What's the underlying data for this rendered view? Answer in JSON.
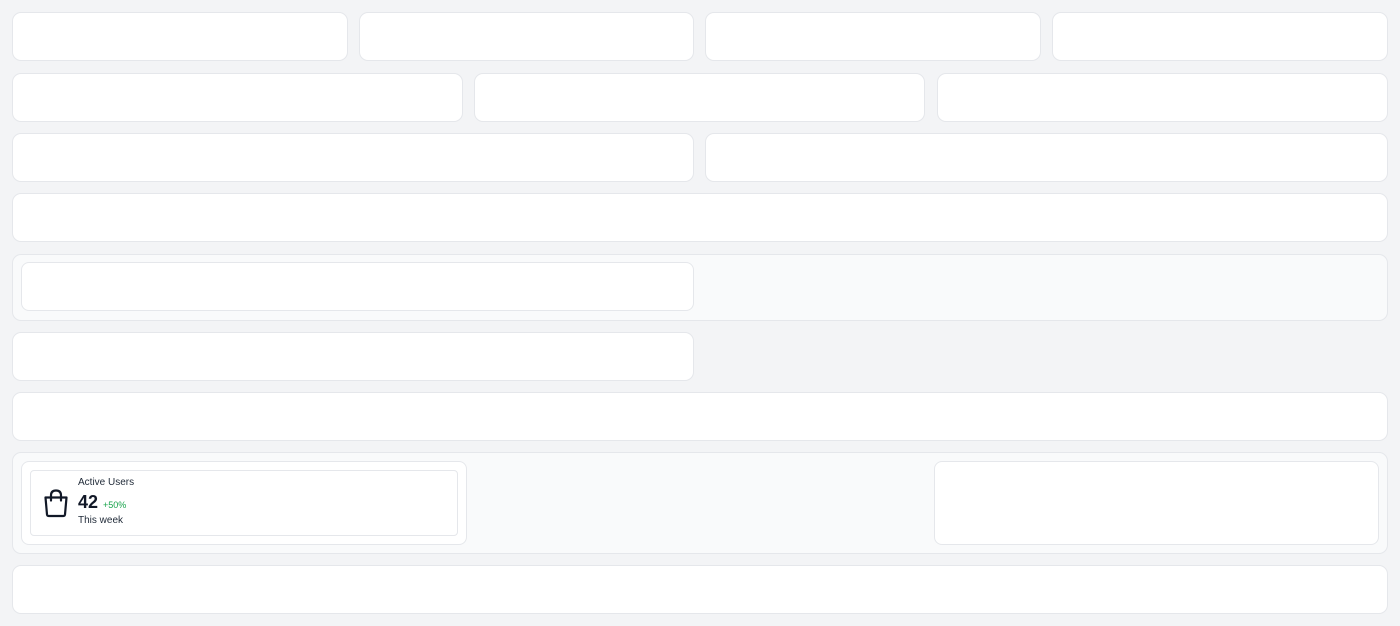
{
  "stat_card": {
    "title": "Active Users",
    "value": "42",
    "change": "+50%",
    "subtitle": "This week",
    "icon": "shopping-bag-icon",
    "change_color": "#16a34a"
  }
}
